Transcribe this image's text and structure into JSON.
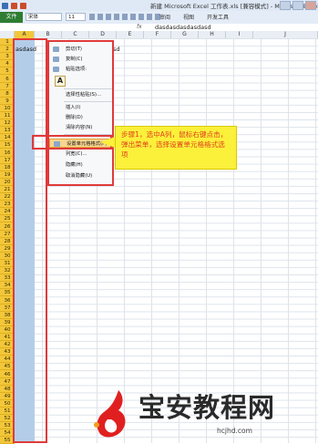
{
  "title_bar": {
    "title": "新建 Microsoft Excel 工作表.xls [兼容模式] - Microsoft Excel"
  },
  "ribbon": {
    "file_tab": "文件",
    "font_name": "宋体",
    "font_size": "11",
    "tabs": [
      "审阅",
      "视图",
      "开发工具"
    ]
  },
  "formula_bar": {
    "fx": "fx",
    "value": "dasdasdasdasdasd"
  },
  "columns": [
    "A",
    "B",
    "C",
    "D",
    "E",
    "F",
    "G",
    "H",
    "I",
    "J"
  ],
  "rows": [
    "1",
    "2",
    "3",
    "4",
    "5",
    "6",
    "7",
    "8",
    "9",
    "10",
    "11",
    "12",
    "13",
    "14",
    "15",
    "16",
    "17",
    "18",
    "19",
    "20",
    "21",
    "22",
    "23",
    "24",
    "25",
    "26",
    "27",
    "28",
    "29",
    "30",
    "31",
    "32",
    "33",
    "34",
    "35",
    "36",
    "37",
    "38",
    "39",
    "40",
    "41",
    "42",
    "43",
    "44",
    "45",
    "46",
    "47",
    "48",
    "49",
    "50",
    "51",
    "52",
    "53",
    "54",
    "55"
  ],
  "cell_A1": "asdasd",
  "cell_A1_rest": "asd",
  "context_menu": {
    "items": [
      {
        "label": "剪切(T)",
        "icon": "scissors-icon"
      },
      {
        "label": "复制(C)",
        "icon": "copy-icon"
      },
      {
        "label": "粘贴选项:",
        "icon": "clipboard-icon"
      },
      {
        "label": "选择性粘贴(S)...",
        "icon": ""
      },
      {
        "label": "插入(I)",
        "icon": ""
      },
      {
        "label": "删除(D)",
        "icon": ""
      },
      {
        "label": "清除内容(N)",
        "icon": ""
      },
      {
        "label": "设置单元格格式(F)...",
        "icon": "format-cells-icon"
      },
      {
        "label": "列宽(C)...",
        "icon": ""
      },
      {
        "label": "隐藏(H)",
        "icon": ""
      },
      {
        "label": "取消隐藏(U)",
        "icon": ""
      }
    ],
    "paste_glyph": "A"
  },
  "callout": {
    "text": "步骤1，选中A列，鼠标右键点击，弹出菜单，选择设置单元格格式选项"
  },
  "watermark": {
    "title": "宝安教程网",
    "url": "hcjhd.com"
  },
  "colors": {
    "row_header": "#f2c73a",
    "selected_column": "#b3cde9",
    "highlight_box": "#e03a3a",
    "callout_bg": "#fbf03a",
    "callout_text": "#e0401a"
  }
}
